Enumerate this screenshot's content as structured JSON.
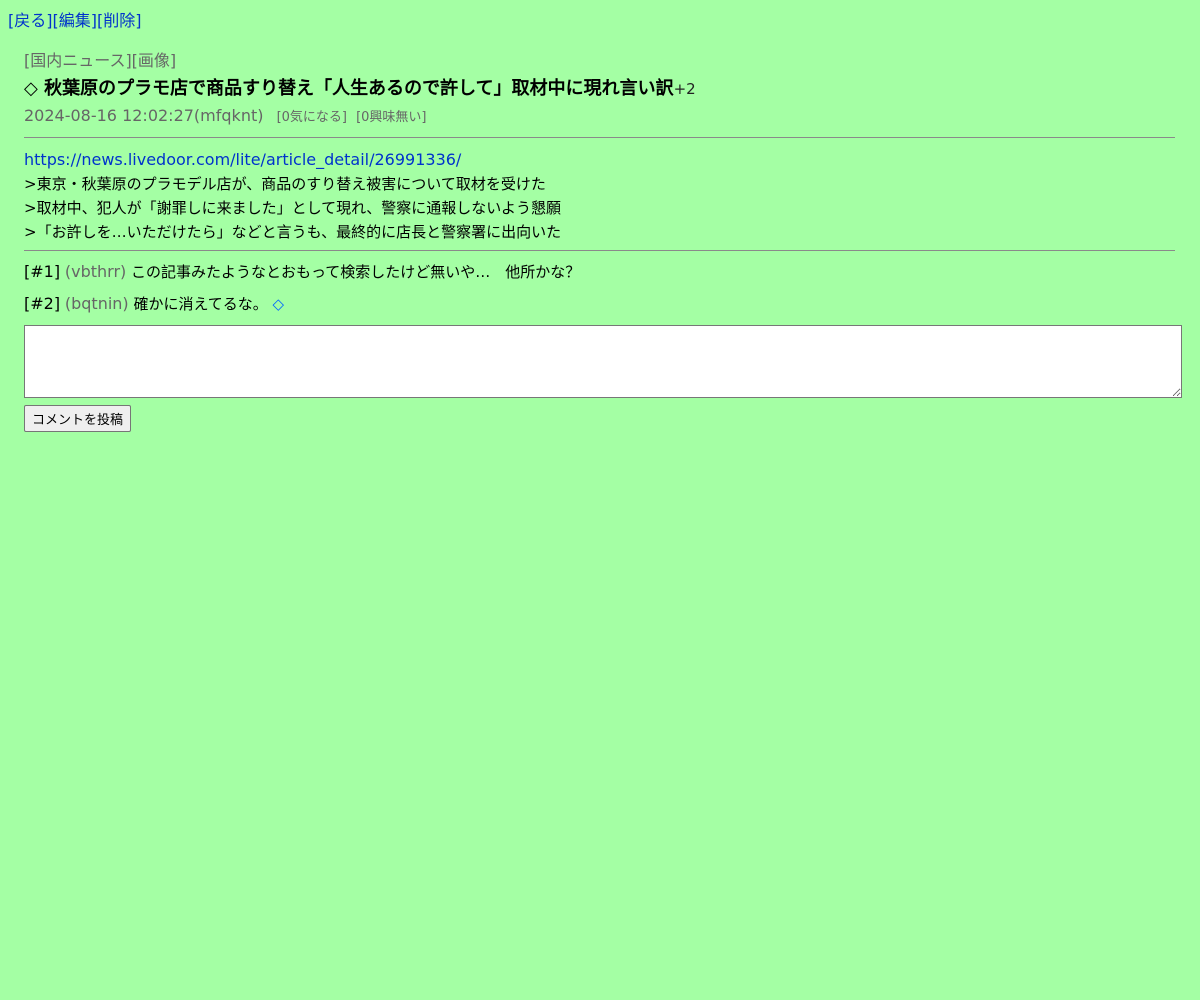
{
  "nav": {
    "back": "[戻る]",
    "edit": "[編集]",
    "delete": "[削除]"
  },
  "post": {
    "categories": "[国内ニュース][画像]",
    "title_icon": "◇",
    "title": "秋葉原のプラモ店で商品すり替え「人生あるので許して」取材中に現れ言い訳",
    "title_plus": "+2",
    "datetime_author": "2024-08-16 12:02:27(mfqknt)",
    "interest": "[0気になる]",
    "no_interest": "[0興味無い]",
    "url": "https://news.livedoor.com/lite/article_detail/26991336/",
    "quotes": [
      ">東京・秋葉原のプラモデル店が、商品のすり替え被害について取材を受けた",
      ">取材中、犯人が「謝罪しに来ました」として現れ、警察に通報しないよう懇願",
      ">「お許しを…いただけたら」などと言うも、最終的に店長と警察署に出向いた"
    ]
  },
  "comments": [
    {
      "num": "[#1]",
      "uid": "(vbthrr)",
      "text": "この記事みたようなとおもって検索したけど無いや…　他所かな？",
      "extra": ""
    },
    {
      "num": "[#2]",
      "uid": "(bqtnin)",
      "text": "確かに消えてるな。",
      "extra": "◇"
    }
  ],
  "form": {
    "textarea_value": "",
    "submit_label": "コメントを投稿"
  },
  "colors": {
    "background": "#a4ffa4",
    "link": "#0033cc",
    "muted": "#666666"
  }
}
